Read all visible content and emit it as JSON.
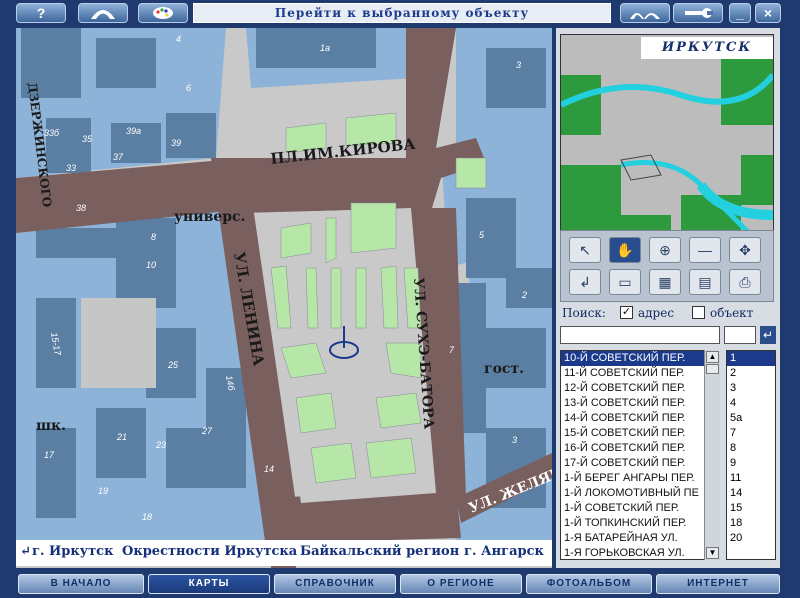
{
  "header": {
    "title": "Перейти к выбранному объекту",
    "help_label": "?",
    "minimize_label": "_",
    "close_label": "×"
  },
  "map": {
    "labels": {
      "square": "ПЛ.ИМ.КИРОВА",
      "lenina": "УЛ. ЛЕНИНА",
      "sukhe": "УЛ. СУХЭ-БАТОРА",
      "zhelyab": "УЛ. ЖЕЛЯБ",
      "dzerzh": "ДЗЕРЖИНСКОГО",
      "univ": "универс.",
      "gost": "гост.",
      "shk": "шк."
    },
    "house_numbers": [
      "33б",
      "35",
      "39а",
      "33",
      "37",
      "39",
      "38",
      "4",
      "6",
      "8",
      "10",
      "15-17",
      "25",
      "14б",
      "27",
      "23",
      "21",
      "19",
      "17",
      "18",
      "14",
      "1а",
      "2",
      "3",
      "5",
      "7",
      "3"
    ]
  },
  "links": {
    "back_symbol": "↵",
    "city": "г. Иркутск",
    "surroundings": "Окрестности Иркутска",
    "baikal": "Байкальский регион",
    "angarsk": "г. Ангарск"
  },
  "minimap": {
    "title": "ИРКУТСК"
  },
  "search": {
    "label": "Поиск:",
    "address_label": "адрес",
    "address_checked": true,
    "object_label": "объект",
    "object_checked": false,
    "street_value": "",
    "number_value": ""
  },
  "streets": [
    "10-Й СОВЕТСКИЙ ПЕР.",
    "11-Й СОВЕТСКИЙ ПЕР.",
    "12-Й СОВЕТСКИЙ ПЕР.",
    "13-Й СОВЕТСКИЙ ПЕР.",
    "14-Й СОВЕТСКИЙ ПЕР.",
    "15-Й СОВЕТСКИЙ ПЕР.",
    "16-Й СОВЕТСКИЙ ПЕР.",
    "17-Й СОВЕТСКИЙ ПЕР.",
    "1-Й БЕРЕГ АНГАРЫ ПЕР.",
    "1-Й ЛОКОМОТИВНЫЙ ПЕ",
    "1-Й СОВЕТСКИЙ ПЕР.",
    "1-Й ТОПКИНСКИЙ ПЕР.",
    "1-Я БАТАРЕЙНАЯ УЛ.",
    "1-Я ГОРЬКОВСКАЯ УЛ."
  ],
  "numbers": [
    "1",
    "2",
    "3",
    "4",
    "5а",
    "7",
    "8",
    "9",
    "11",
    "14",
    "15",
    "18",
    "20"
  ],
  "nav": {
    "home": "В НАЧАЛО",
    "maps": "КАРТЫ",
    "reference": "СПРАВОЧНИК",
    "region": "О РЕГИОНЕ",
    "photo": "ФОТОАЛЬБОМ",
    "internet": "ИНТЕРНЕТ"
  },
  "colors": {
    "accent": "#1c3a8c",
    "road": "#7a5f5f",
    "park": "#b7e6a9",
    "building": "#5a7fa3",
    "block": "#8db3d8"
  }
}
